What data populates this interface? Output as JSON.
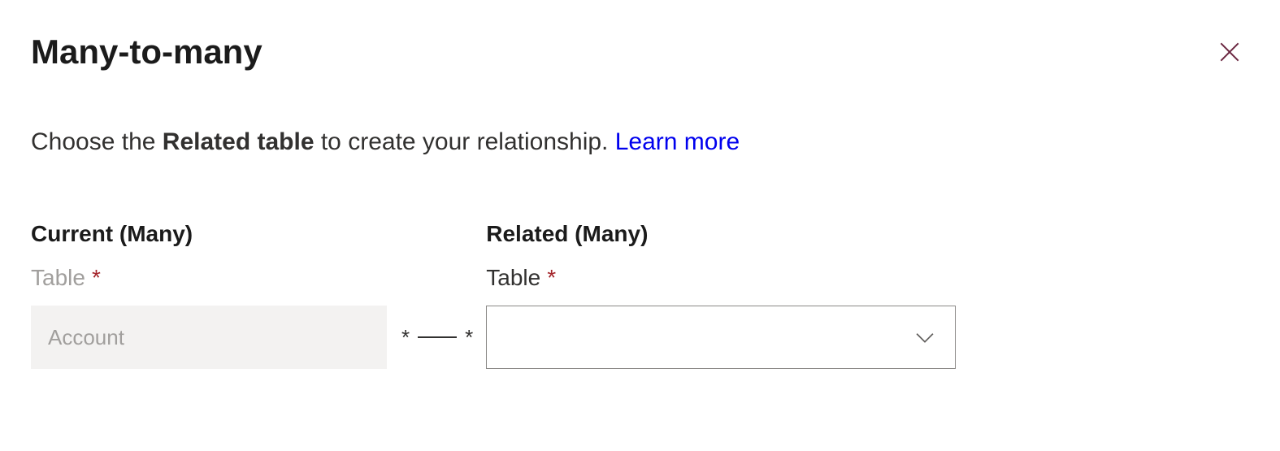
{
  "header": {
    "title": "Many-to-many"
  },
  "description": {
    "prefix": "Choose the ",
    "bold": "Related table",
    "suffix": " to create your relationship. ",
    "link": "Learn more"
  },
  "current": {
    "heading": "Current (Many)",
    "label": "Table",
    "required": "*",
    "value": "Account"
  },
  "connector": {
    "left": "*",
    "right": "*"
  },
  "related": {
    "heading": "Related (Many)",
    "label": "Table",
    "required": "*",
    "value": ""
  }
}
